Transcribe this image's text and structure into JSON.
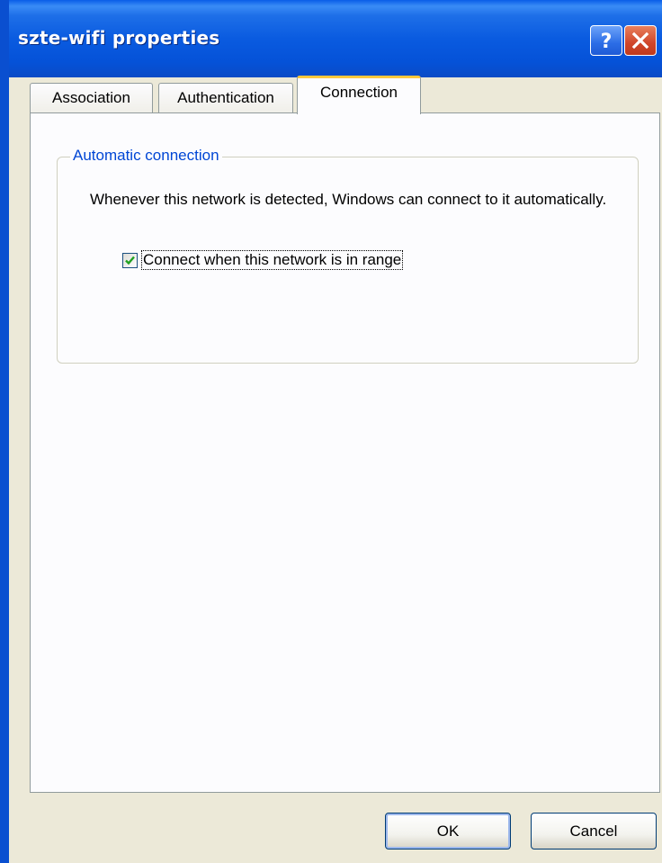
{
  "window": {
    "title": "szte-wifi properties"
  },
  "tabs": [
    {
      "label": "Association"
    },
    {
      "label": "Authentication"
    },
    {
      "label": "Connection",
      "selected": true
    }
  ],
  "connection": {
    "group_title": "Automatic connection",
    "description": "Whenever this network is detected, Windows can connect to it automatically.",
    "checkbox_label": "Connect when this network is in range",
    "checkbox_checked": true
  },
  "buttons": {
    "ok": "OK",
    "cancel": "Cancel"
  },
  "colors": {
    "titlebar": "#0a5be0",
    "accent_tab": "#ffc83c",
    "group_title": "#0046d5",
    "checkmark": "#21a121"
  }
}
